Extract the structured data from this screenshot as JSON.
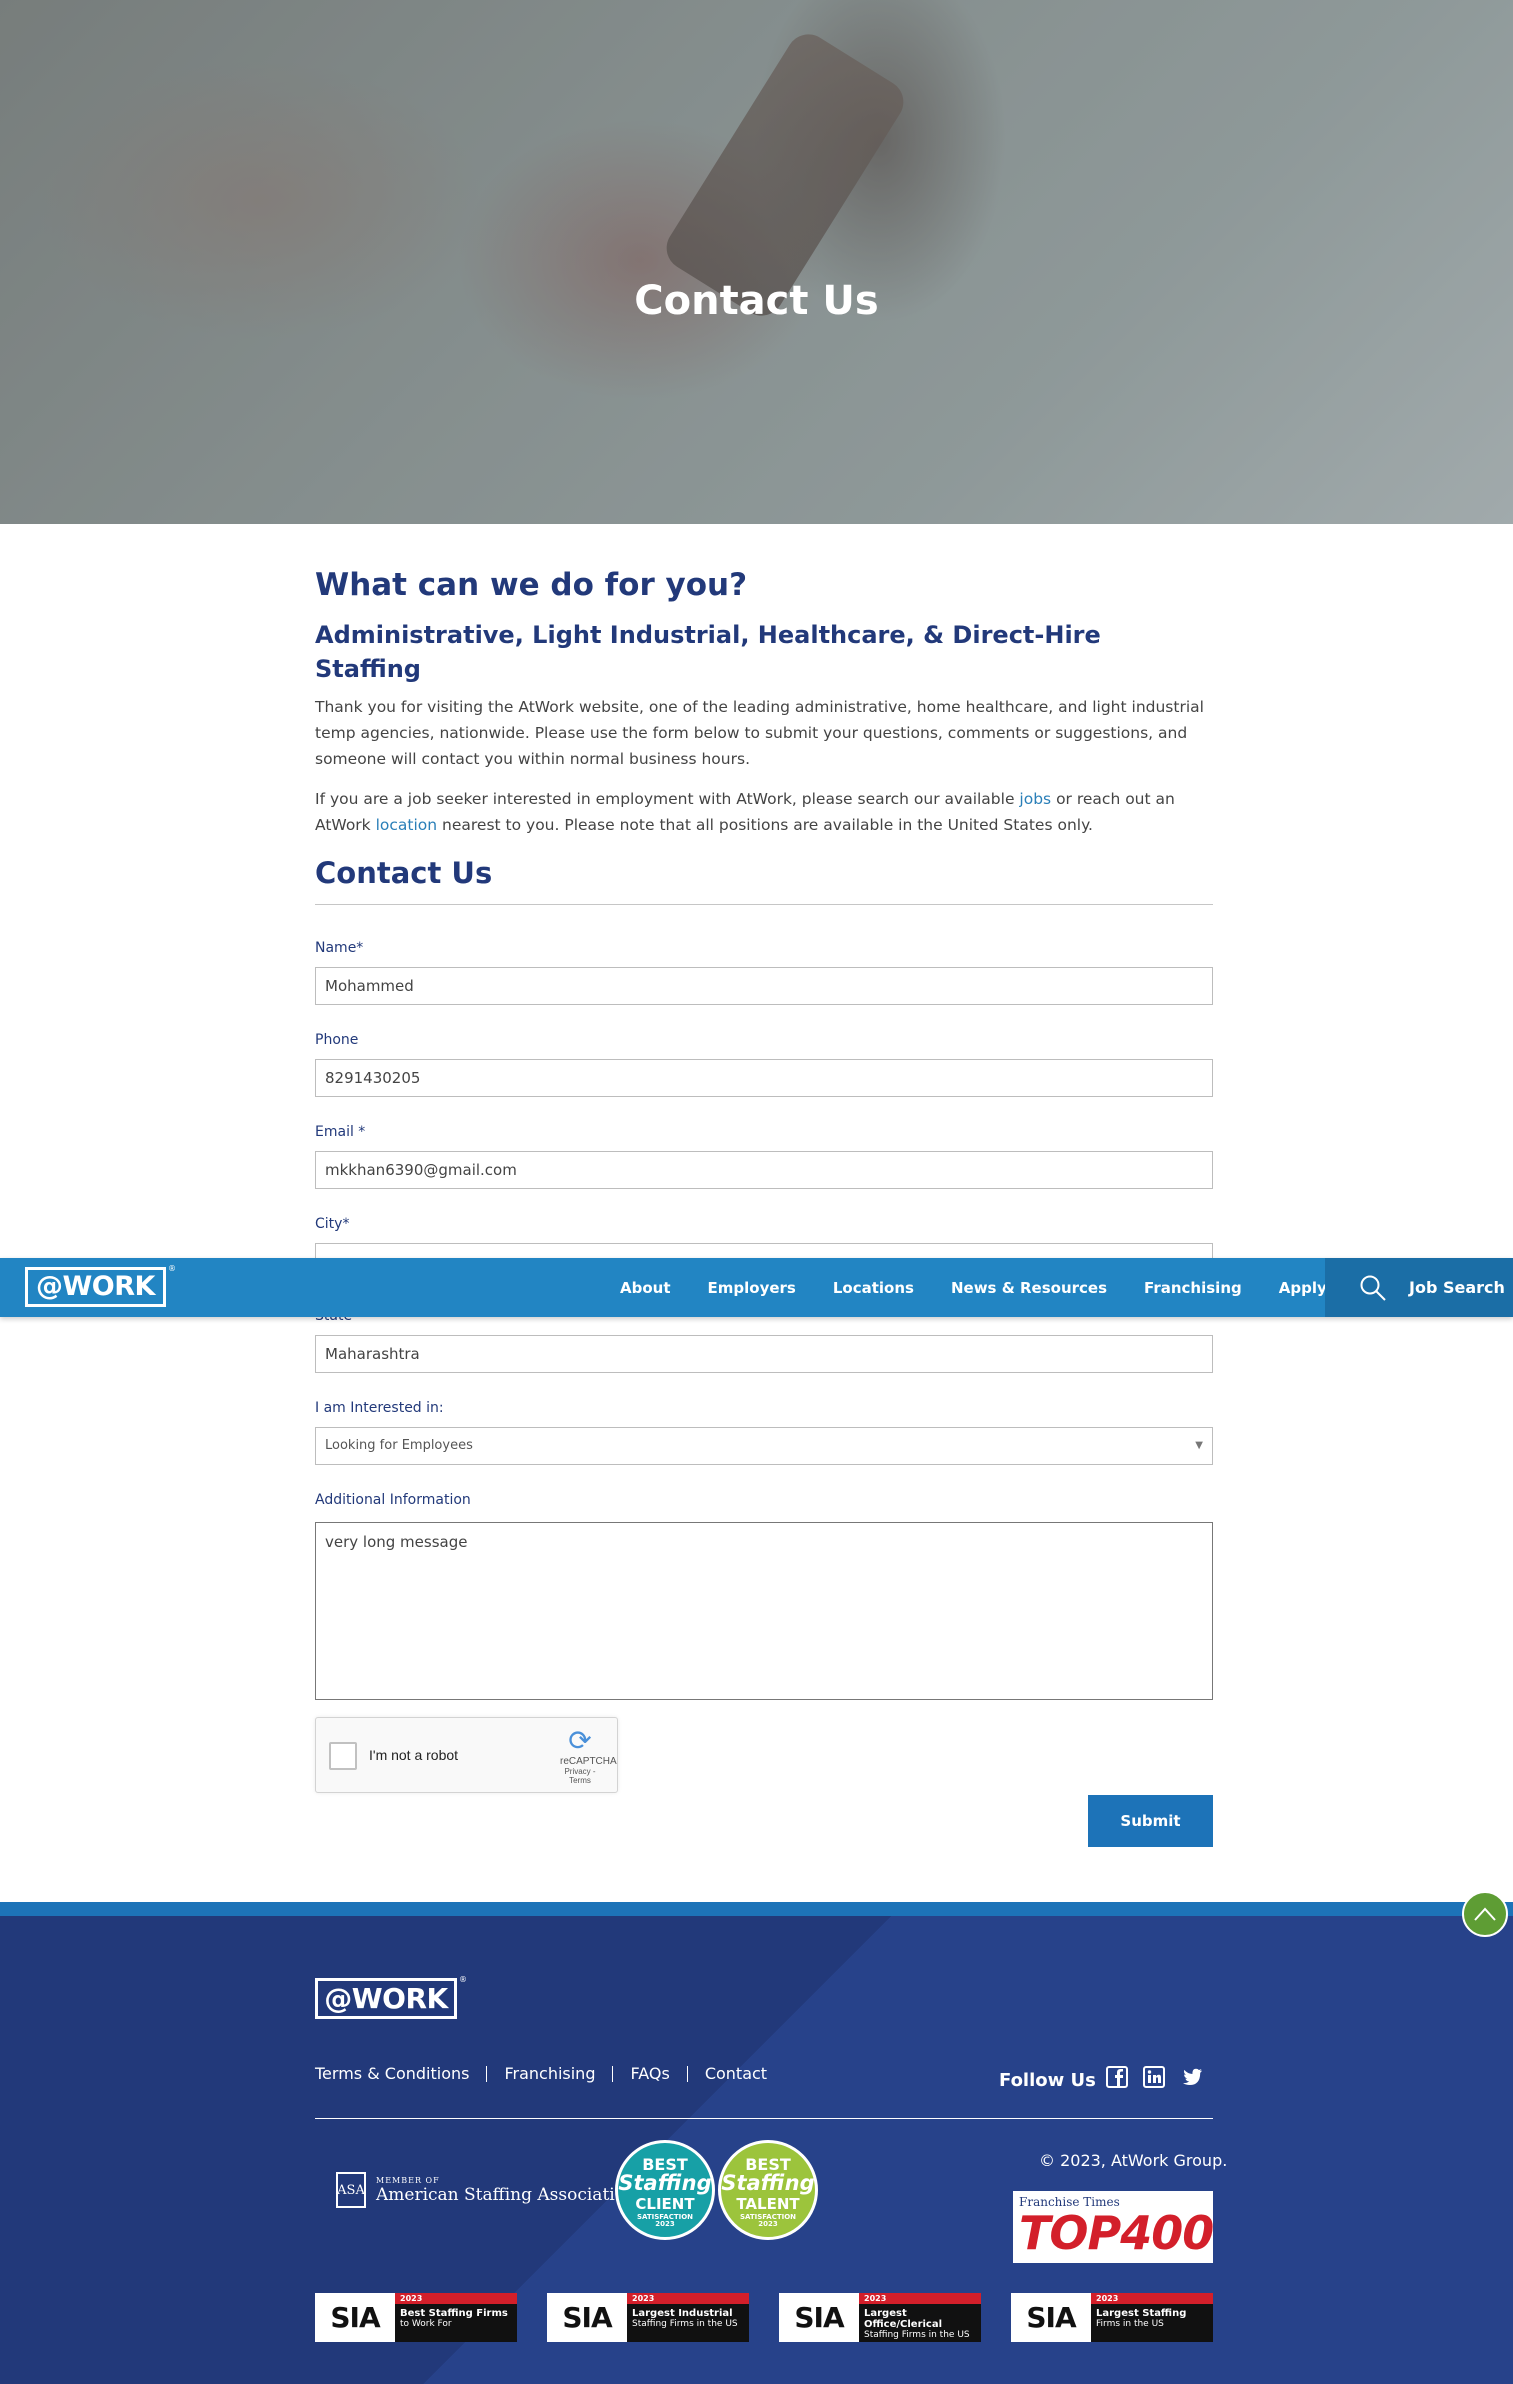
{
  "hero": {
    "title": "Contact Us"
  },
  "intro": {
    "heading": "What can we do for you?",
    "subheading": "Administrative, Light Industrial, Healthcare, & Direct-Hire Staffing",
    "para1": "Thank you for visiting the AtWork website, one of the leading administrative, home healthcare, and light industrial temp agencies, nationwide. Please use the form below to submit your questions, comments or suggestions, and someone will contact you within normal business hours.",
    "para2_before": "If you are a job seeker interested in employment with AtWork, please search our available ",
    "para2_link1": "jobs",
    "para2_middle": " or reach out an AtWork ",
    "para2_link2": "location",
    "para2_after": " nearest to you. Please note that all positions are available in the United States only."
  },
  "form": {
    "title": "Contact Us",
    "name_label": "Name*",
    "name_value": "Mohammed",
    "phone_label": "Phone",
    "phone_value": "8291430205",
    "email_label": "Email *",
    "email_value": "mkkhan6390@gmail.com",
    "city_label": "City*",
    "state_label": "State*",
    "state_value": "Maharashtra",
    "interest_label": "I am Interested in:",
    "interest_value": "Looking for Employees",
    "info_label": "Additional Information",
    "info_value": "very long message",
    "captcha_label": "I'm not a robot",
    "captcha_brand": "reCAPTCHA",
    "captcha_terms": "Privacy - Terms",
    "submit_label": "Submit"
  },
  "nav": {
    "logo": "@WORK",
    "reg": "®",
    "items": [
      "About",
      "Employers",
      "Locations",
      "News & Resources",
      "Franchising",
      "Apply Now"
    ],
    "job_search": "Job Search"
  },
  "footer": {
    "logo": "@WORK",
    "reg": "®",
    "links": [
      "Terms & Conditions",
      "Franchising",
      "FAQs",
      "Contact"
    ],
    "follow": "Follow Us",
    "copyright": "© 2023, AtWork Group.",
    "asa_mark": "ASA",
    "asa_small": "MEMBER OF",
    "asa_name": "American Staffing Association",
    "badge_client": {
      "l1": "BEST",
      "l2": "Staffing",
      "l3": "CLIENT",
      "l4": "SATISFACTION",
      "l5": "2023"
    },
    "badge_talent": {
      "l1": "BEST",
      "l2": "Staffing",
      "l3": "TALENT",
      "l4": "SATISFACTION",
      "l5": "2023"
    },
    "top400_small": "Franchise Times",
    "top400_big": "TOP400",
    "sia": [
      {
        "logo": "SIA",
        "year": "2023",
        "t1": "Best Staffing Firms",
        "t2": "to Work For"
      },
      {
        "logo": "SIA",
        "year": "2023",
        "t1": "Largest Industrial",
        "t2": "Staffing Firms in the US"
      },
      {
        "logo": "SIA",
        "year": "2023",
        "t1": "Largest Office/Clerical",
        "t2": "Staffing Firms in the US"
      },
      {
        "logo": "SIA",
        "year": "2023",
        "t1": "Largest Staffing",
        "t2": "Firms in the US"
      }
    ]
  },
  "colors": {
    "navy": "#22397a",
    "blue": "#2285c3",
    "accent": "#1d73b8",
    "green": "#5e9d34"
  }
}
